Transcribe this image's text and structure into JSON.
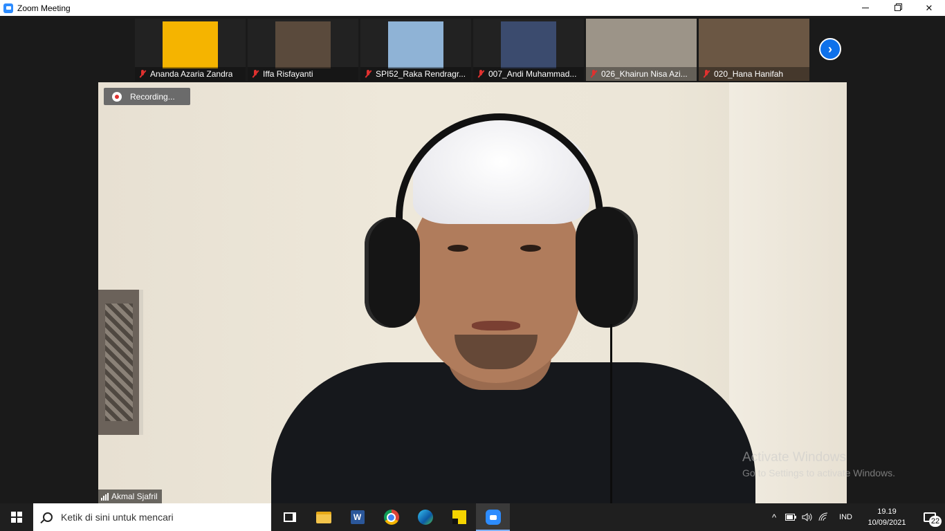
{
  "window": {
    "title": "Zoom Meeting",
    "controls": {
      "minimize": "minimize-icon",
      "restore": "restore-icon",
      "close": "✕"
    }
  },
  "participants": [
    {
      "name": "Ananda Azaria Zandra",
      "muted": true,
      "bg": "#f5b400"
    },
    {
      "name": "Iffa Risfayanti",
      "muted": true,
      "bg": "#5a4a3c"
    },
    {
      "name": "SPI52_Raka Rendragr...",
      "muted": true,
      "bg": "#8fb3d6"
    },
    {
      "name": "007_Andi Muhammad...",
      "muted": true,
      "bg": "#3b4b6e"
    },
    {
      "name": "026_Khairun Nisa Azi...",
      "muted": true,
      "bg": "#9c9488"
    },
    {
      "name": "020_Hana Hanifah",
      "muted": true,
      "bg": "#6b5744"
    }
  ],
  "strip_next_icon": "chevron-right-icon",
  "main_video": {
    "recording_label": "Recording...",
    "speaker_name": "Akmal Sjafril"
  },
  "watermark": {
    "title": "Activate Windows",
    "subtitle": "Go to Settings to activate Windows."
  },
  "taskbar": {
    "search_placeholder": "Ketik di sini untuk mencari",
    "apps": [
      "task-view-icon",
      "file-explorer-icon",
      "word-icon",
      "chrome-icon",
      "edge-icon",
      "sticky-notes-icon",
      "zoom-icon"
    ],
    "word_letter": "W",
    "tray": {
      "chevron": "^",
      "language": "IND",
      "time": "19.19",
      "date": "10/09/2021",
      "notifications": "22"
    }
  }
}
